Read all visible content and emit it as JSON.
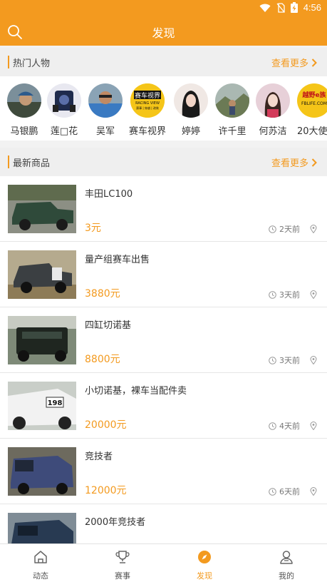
{
  "status": {
    "time": "4:56"
  },
  "header": {
    "title": "发现"
  },
  "hot_people": {
    "label": "热门人物",
    "more": "查看更多",
    "people": [
      {
        "name": "马银鹏"
      },
      {
        "name": "莲□花"
      },
      {
        "name": "吴军"
      },
      {
        "name": "赛车视界"
      },
      {
        "name": "婷婷"
      },
      {
        "name": "许千里"
      },
      {
        "name": "何苏洁"
      },
      {
        "name": "20大使"
      }
    ],
    "logo_text": {
      "racing_top": "赛车视界",
      "racing_mid": "RACING VIEW",
      "racing_bot": "赛事 | 穿越 | 改装",
      "fblife_top": "越野e族",
      "fblife_mid": "FBLIFE.COM"
    }
  },
  "new_goods": {
    "label": "最新商品",
    "more": "查看更多",
    "items": [
      {
        "title": "丰田LC100",
        "price": "3元",
        "time": "2天前"
      },
      {
        "title": "量产组赛车出售",
        "price": "3880元",
        "time": "3天前"
      },
      {
        "title": "四缸切诺基",
        "price": "8800元",
        "time": "3天前"
      },
      {
        "title": "小切诺基，裸车当配件卖",
        "price": "20000元",
        "time": "4天前",
        "plate": "198"
      },
      {
        "title": "竞技者",
        "price": "12000元",
        "time": "6天前"
      },
      {
        "title": "2000年竞技者",
        "price": "",
        "time": ""
      }
    ]
  },
  "tabbar": {
    "tabs": [
      {
        "label": "动态",
        "icon": "home-icon"
      },
      {
        "label": "赛事",
        "icon": "trophy-icon"
      },
      {
        "label": "发现",
        "icon": "compass-icon",
        "active": true
      },
      {
        "label": "我的",
        "icon": "profile-icon"
      }
    ]
  },
  "colors": {
    "accent": "#f39a1f",
    "section_bg": "#efefef",
    "text": "#333333"
  }
}
